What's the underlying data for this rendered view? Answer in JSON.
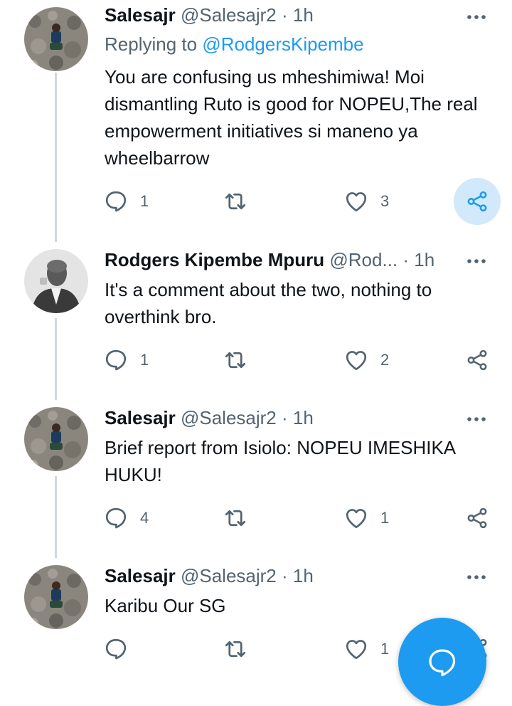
{
  "colors": {
    "accent": "#1d9bf0",
    "muted": "#536471",
    "thread_line": "#cfd9de"
  },
  "icons": {
    "reply": "reply-icon",
    "retweet": "retweet-icon",
    "like": "heart-icon",
    "share": "share-icon",
    "more": "more-icon",
    "compose": "compose-icon"
  },
  "tweets": [
    {
      "name": "Salesajr",
      "handle": "@Salesajr2",
      "separator": "·",
      "time": "1h",
      "replying_prefix": "Replying to",
      "replying_to": "@RodgersKipembe",
      "text": "You are confusing us mheshimiwa! Moi dismantling Ruto is good for NOPEU,The real empowerment initiatives si maneno ya wheelbarrow",
      "replies": "1",
      "likes": "3"
    },
    {
      "name": "Rodgers Kipembe Mpuru",
      "handle": "@Rod...",
      "separator": "·",
      "time": "1h",
      "text": "It's a comment about the two, nothing to overthink bro.",
      "replies": "1",
      "likes": "2"
    },
    {
      "name": "Salesajr",
      "handle": "@Salesajr2",
      "separator": "·",
      "time": "1h",
      "text": "Brief report from Isiolo: NOPEU IMESHIKA HUKU!",
      "replies": "4",
      "likes": "1"
    },
    {
      "name": "Salesajr",
      "handle": "@Salesajr2",
      "separator": "·",
      "time": "1h",
      "text": "Karibu Our SG",
      "replies": "",
      "likes": "1"
    }
  ]
}
